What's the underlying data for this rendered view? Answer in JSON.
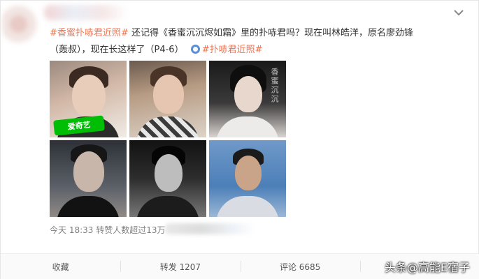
{
  "post": {
    "hashtag1": "#香蜜扑哧君近照#",
    "text1": "还记得《香蜜沉沉烬如霜》里的扑哧君吗？现在叫林皓洋，原名廖劲锋",
    "text2": "（轰叔），现在长这样了（P4-6）",
    "hashtag2": "#扑哧君近照#"
  },
  "photos": {
    "iqiyi_label": "爱奇艺",
    "poster_text": "香蜜沉沉"
  },
  "meta": {
    "time": "今天 18:33",
    "reposts_summary": "转赞人数超过13万"
  },
  "actions": {
    "collect": "收藏",
    "repost": "转发 1207",
    "comment": "评论 6685",
    "like": ""
  },
  "watermark": "头条@高能E宿子",
  "colors": {
    "hashtag": "#eb7350",
    "iqiyi_green": "#00be06"
  }
}
